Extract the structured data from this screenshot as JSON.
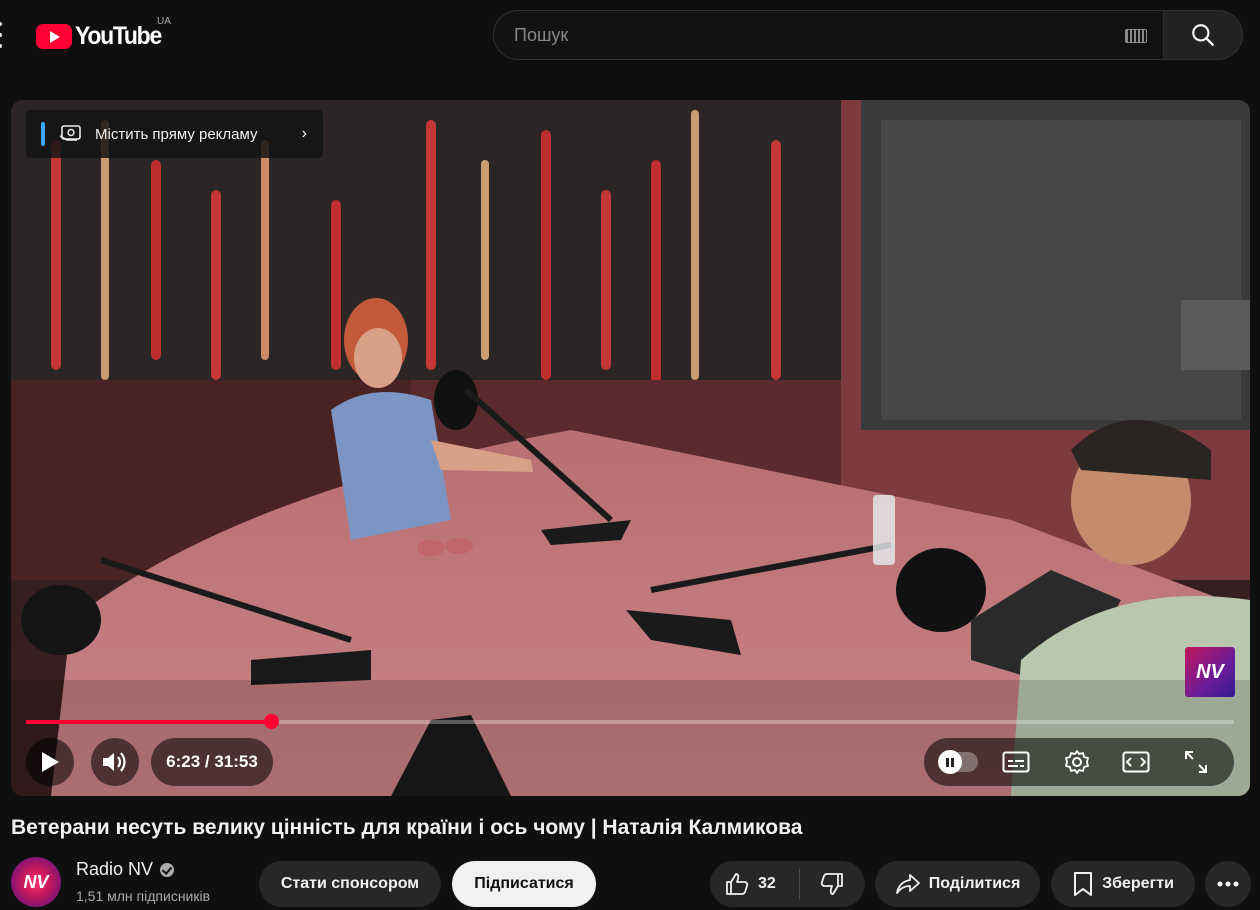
{
  "masthead": {
    "logo_text": "YouTube",
    "country_code": "UA",
    "search_placeholder": "Пошук"
  },
  "player": {
    "ad_label": "Містить пряму рекламу",
    "watermark_text": "NV",
    "time_current": "6:23",
    "time_total": "31:53",
    "time_display": "6:23 / 31:53",
    "progress_fraction": 0.2027,
    "accent_color": "#ff0033"
  },
  "video": {
    "title": "Ветерани несуть велику цінність для країни і ось чому | Наталія Калмикова"
  },
  "channel": {
    "name": "Radio NV",
    "avatar_text": "NV",
    "subscribers": "1,51 млн підписників",
    "verified": true
  },
  "actions": {
    "sponsor_label": "Стати спонсором",
    "subscribe_label": "Підписатися",
    "like_count": "32",
    "share_label": "Поділитися",
    "save_label": "Зберегти"
  },
  "icons": [
    "menu-icon",
    "youtube-logo-icon",
    "keyboard-icon",
    "search-icon",
    "ad-info-icon",
    "chevron-right-icon",
    "play-icon",
    "volume-icon",
    "autoplay-icon",
    "subtitles-icon",
    "settings-icon",
    "theater-icon",
    "fullscreen-icon",
    "verified-icon",
    "like-icon",
    "dislike-icon",
    "share-icon",
    "save-icon",
    "more-icon"
  ]
}
